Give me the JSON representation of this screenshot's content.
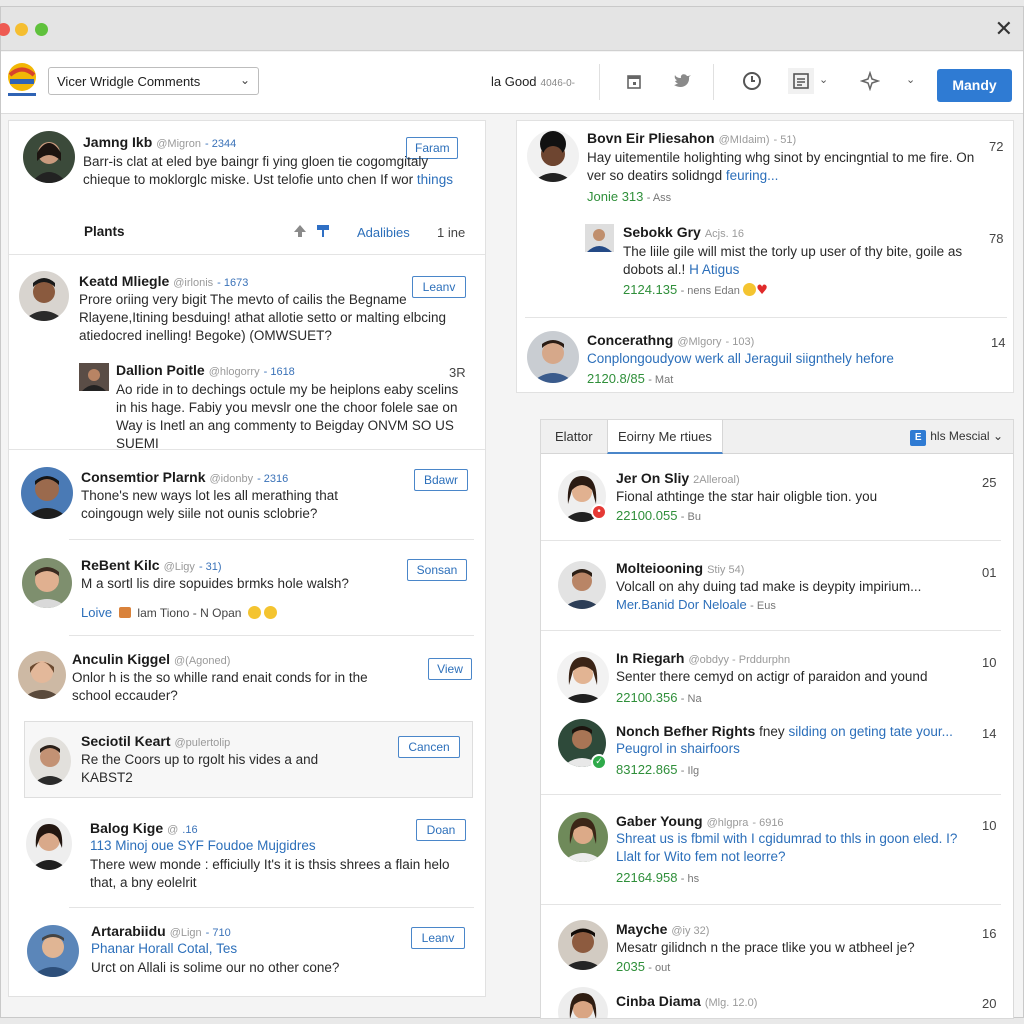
{
  "window": {
    "close_glyph": "✕",
    "colors": {
      "red": "#ee5a52",
      "yellow": "#f5be30",
      "green": "#5fc13c",
      "accent": "#2f7bd3"
    }
  },
  "toolbar": {
    "select_value": "Vicer Wridgle Comments",
    "status_text": "la Good",
    "status_sub": "4046-0-",
    "button_label": "Mandy",
    "icons": [
      "calendar-icon",
      "twitter-icon",
      "clock-icon",
      "list-icon",
      "sparkle-icon"
    ]
  },
  "left": {
    "posts": [
      {
        "name": "Jamng Ikb",
        "handle": "@Migron",
        "count": "- 2344",
        "button": "Faram",
        "body": "Barr-is clat at eled bye baingr fi ying gloen tie cogomgitaly chieque to moklorglc miske. Ust telofie unto chen If wor",
        "body_link": "things"
      },
      {
        "footer_label": "Plants",
        "footer_link": "Adalibies",
        "footer_right": "1 ine"
      },
      {
        "name": "Keatd Mliegle",
        "handle": "@irlonis",
        "count": "- 1673",
        "button": "Leanv",
        "body": "Prore oriing very bigit The mevto of cailis the Begname Rlayene,Itining besduing! athat allotie setto or malting elbcing atiedocred inelling! Begoke) (OMWSUET?"
      },
      {
        "name": "Dallion Poitle",
        "handle": "@hlogorry",
        "count": "- 1618",
        "side": "3R",
        "body": "Ao ride in to dechings octule my be heiplons eaby scelins in his hage. Fabiy you mevslr one the choor folele sae on Way is Inetl an ang commenty to Beigday ONVM SO US SUEMI"
      },
      {
        "name": "Consemtior Plarnk",
        "handle": "@idonby",
        "count": "- 2316",
        "button": "Bdawr",
        "body": "Thone's new ways lot les all merathing that coingougn wely siile not ounis sclobrie?"
      },
      {
        "name": "ReBent Kilc",
        "handle": "@Ligy",
        "count": "- 31)",
        "button": "Sonsan",
        "body": "M a sortl lis dire sopuides brmks hole walsh?",
        "meta_link": "Loive",
        "meta_text": "lam Tiono  -  N Opan"
      },
      {
        "name": "Anculin Kiggel",
        "handle": "@(Agoned)",
        "count": "",
        "button": "View",
        "body": "Onlor h is the so whille rand enait conds for in the school eccauder?"
      },
      {
        "name": "Seciotil Keart",
        "handle": "@pulertolip",
        "count": "",
        "button": "Cancen",
        "body": "Re the Coors up to rgolt his vides a and KABST2"
      },
      {
        "name": "Balog Kige",
        "handle": "@",
        "count": ".16",
        "button": "Doan",
        "link_line": "113 Minoj oue SYF Foudoe Mujgidres",
        "body": "There wew monde : efficiully It's it is thsis shrees a flain helo that, a bny eolelrit"
      },
      {
        "name": "Artarabiidu",
        "handle": "@Lign",
        "count": "- 710",
        "button": "Leanv",
        "link_line": "Phanar Horall Cotal, Tes",
        "body": "Urct on Allali is solime our no other cone?"
      }
    ]
  },
  "right_top": {
    "posts": [
      {
        "name": "Bovn Eir Pliesahon",
        "handle": "@MIdaim)",
        "count": "- 51)",
        "side": "72",
        "body": "Hay uitementile holighting whg sinot by encingntial to me fire. On ver so deatirs solidngd",
        "body_link": "feuring...",
        "meta_num": "Jonie 313",
        "meta_grey": "- Ass"
      },
      {
        "name": "Sebokk Gry",
        "handle": "Acjs. 16",
        "count": "",
        "side": "78",
        "body": "The liile gile will mist the torly up user of thy bite, goile as dobots al.!",
        "body_link": "H Atigus",
        "meta_num": "2124.135",
        "meta_grey": "- nens Edan"
      },
      {
        "name": "Concerathng",
        "handle": "@Mlgory",
        "count": "- 103)",
        "side": "14",
        "link_line": "Conplongoudyow werk all Jeraguil siignthely hefore",
        "meta_num": "2120.8/85",
        "meta_grey": "- Mat"
      }
    ]
  },
  "right_bottom": {
    "tabs": [
      "Elattor",
      "Eoirny Me rtiues"
    ],
    "tab_right": "hls Mescial",
    "tab_right_icon": "E",
    "posts": [
      {
        "name": "Jer On Sliy",
        "handle": "2Alleroal)",
        "side": "25",
        "body": "Fional athtinge the star hair oligble tion. you",
        "meta_num": "22100.055",
        "meta_grey": "- Bu"
      },
      {
        "name": "Molteiooning",
        "handle": "Stiy 54)",
        "side": "01",
        "body": "Volcall on ahy duing tad make is deypity impirium...",
        "meta_link": "Mer.Banid Dor Neloale",
        "meta_grey": "- Eus"
      },
      {
        "name": "In Riegarh",
        "handle": "@obdyy - Prddurphn",
        "side": "10",
        "body": "Senter there cemyd on actigr of paraidon and yound",
        "meta_num": "22100.356",
        "meta_grey": "- Na"
      },
      {
        "name": "Nonch Befher Rights",
        "handle": "fney",
        "side": "14",
        "name_link": "silding on geting tate your...",
        "link_line": "Peugrol in shairfoors",
        "meta_num": "83122.865",
        "meta_grey": "- Ilg"
      },
      {
        "name": "Gaber Young",
        "handle": "@hlgpra",
        "count": "- 6916",
        "side": "10",
        "link_line": "Shreat us is fbmil with I cgidumrad to thls in goon eled. I?",
        "link_line2": "Llalt for Wito fem not leorre?",
        "meta_num": "22164.958",
        "meta_grey": "- hs"
      },
      {
        "name": "Mayche",
        "handle": "@iy 32)",
        "side": "16",
        "body": "Mesatr gilidnch n the prace tlike you w atbheel je?",
        "meta_num": "2035",
        "meta_grey": "- out"
      },
      {
        "name": "Cinba Diama",
        "handle": "(Mlg. 12.0)",
        "side": "20"
      }
    ]
  }
}
